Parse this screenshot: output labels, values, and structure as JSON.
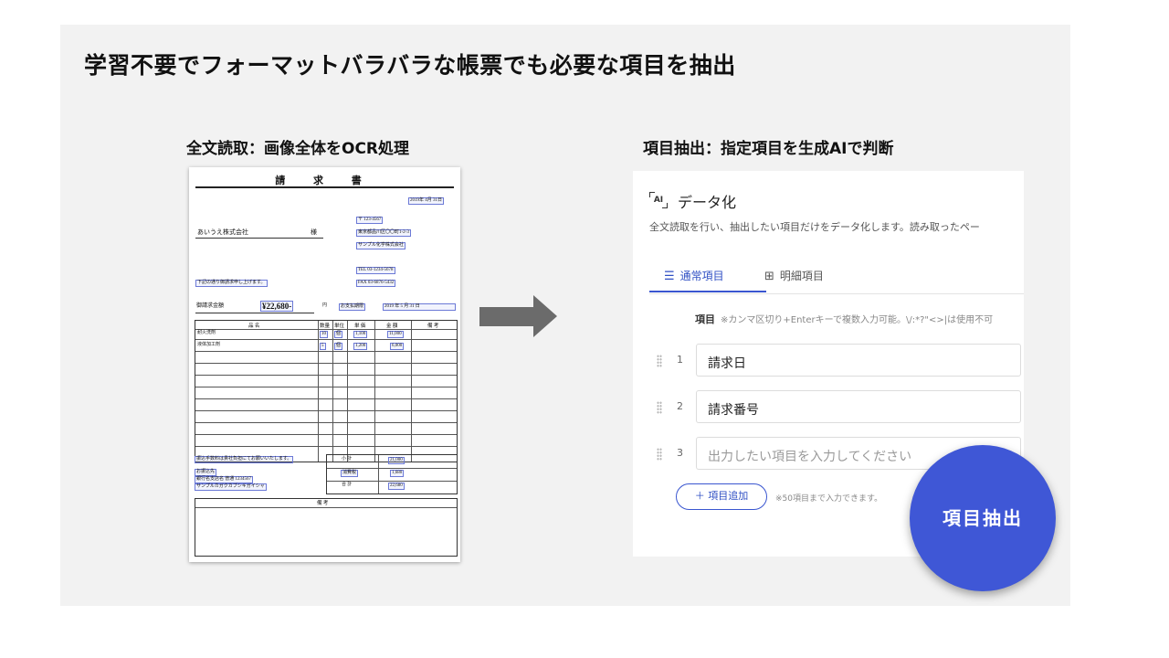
{
  "headline": "学習不要でフォーマットバラバラな帳票でも必要な項目を抽出",
  "left_title": "全文読取：画像全体をOCR処理",
  "right_title": "項目抽出：指定項目を生成AIで判断",
  "invoice": {
    "title": "請 求 書",
    "date": "2019年 4月 31日",
    "recipient": "あいうえ株式会社",
    "honorific": "様",
    "postal": "〒 123-4567",
    "address": "東京都品川区〇〇町1-2-3",
    "company": "サンプル化学株式会社",
    "tel": "TEL 03-1234-5678",
    "fax": "FAX 03-6876-5432",
    "greeting": "下記の通り御請求申し上げます。",
    "amount_label": "御請求金額",
    "amount": "¥22,680-",
    "yen": "円",
    "due_label": "お支払期限",
    "due_date": "2019 年 5 月 31 日",
    "table_headers": [
      "品 名",
      "数量",
      "単位",
      "単 価",
      "金 額",
      "備 考"
    ],
    "rows": [
      {
        "name": "耐火洗剤",
        "qty": "10",
        "unit": "個",
        "price": "1,100",
        "total": "11,000"
      },
      {
        "name": "液体加工剤",
        "qty": "5",
        "unit": "個",
        "price": "1,200",
        "total": "6,000"
      }
    ],
    "transfer_note": "振込手数料は貴社負担にてお願いいたします。",
    "bank_label": "お振込先",
    "bank": "銀行名支店名 普通 1234567",
    "bank_name": "サンプルカガクカブシキガイシャ",
    "subtotal_label": "小 計",
    "subtotal": "21,000",
    "tax_label": "消費税",
    "tax": "1,680",
    "grand_label": "合 計",
    "grand": "22,680",
    "remarks_label": "備 考"
  },
  "panel": {
    "icon_text": "AI",
    "title": "データ化",
    "desc": "全文読取を行い、抽出したい項目だけをデータ化します。読み取ったペー",
    "tabs": [
      {
        "icon": "list-icon",
        "label": "通常項目"
      },
      {
        "icon": "table-icon",
        "label": "明細項目"
      }
    ],
    "hint_label": "項目",
    "hint_text": "※カンマ区切り+Enterキーで複数入力可能。\\/:*?\"<>|は使用不可",
    "items": [
      {
        "num": "1",
        "value": "請求日"
      },
      {
        "num": "2",
        "value": "請求番号"
      }
    ],
    "new_num": "3",
    "placeholder": "出力したい項目を入力してください",
    "add_label": "＋ 項目追加",
    "add_note": "※50項目まで入力できます。",
    "accent": "#3a56d0"
  },
  "extract_button": "項目抽出"
}
